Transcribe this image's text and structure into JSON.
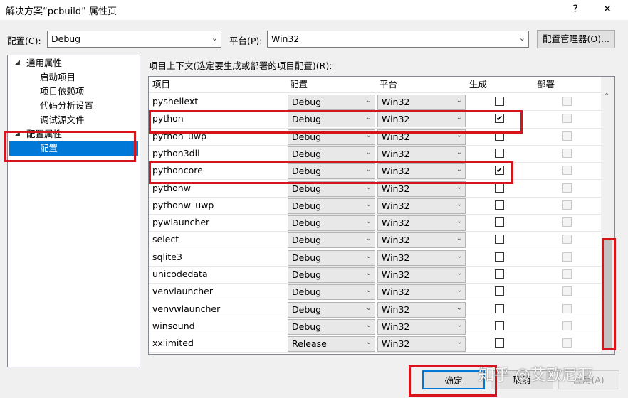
{
  "window": {
    "title": "解决方案“pcbuild” 属性页",
    "help_glyph": "?",
    "close_glyph": "✕"
  },
  "toolbar": {
    "config_label": "配置(C):",
    "config_value": "Debug",
    "platform_label": "平台(P):",
    "platform_value": "Win32",
    "config_manager_label": "配置管理器(O)..."
  },
  "tree": {
    "groups": [
      {
        "label": "通用属性",
        "children": [
          "启动项目",
          "项目依赖项",
          "代码分析设置",
          "调试源文件"
        ]
      },
      {
        "label": "配置属性",
        "children": [
          "配置"
        ]
      }
    ],
    "selected": "配置"
  },
  "grid": {
    "caption": "项目上下文(选定要生成或部署的项目配置)(R):",
    "columns": [
      "项目",
      "配置",
      "平台",
      "生成",
      "部署"
    ],
    "rows": [
      {
        "project": "pyshellext",
        "config": "Debug",
        "platform": "Win32",
        "build": false
      },
      {
        "project": "python",
        "config": "Debug",
        "platform": "Win32",
        "build": true
      },
      {
        "project": "python_uwp",
        "config": "Debug",
        "platform": "Win32",
        "build": false
      },
      {
        "project": "python3dll",
        "config": "Debug",
        "platform": "Win32",
        "build": false
      },
      {
        "project": "pythoncore",
        "config": "Debug",
        "platform": "Win32",
        "build": true
      },
      {
        "project": "pythonw",
        "config": "Debug",
        "platform": "Win32",
        "build": false
      },
      {
        "project": "pythonw_uwp",
        "config": "Debug",
        "platform": "Win32",
        "build": false
      },
      {
        "project": "pywlauncher",
        "config": "Debug",
        "platform": "Win32",
        "build": false
      },
      {
        "project": "select",
        "config": "Debug",
        "platform": "Win32",
        "build": false
      },
      {
        "project": "sqlite3",
        "config": "Debug",
        "platform": "Win32",
        "build": false
      },
      {
        "project": "unicodedata",
        "config": "Debug",
        "platform": "Win32",
        "build": false
      },
      {
        "project": "venvlauncher",
        "config": "Debug",
        "platform": "Win32",
        "build": false
      },
      {
        "project": "venvwlauncher",
        "config": "Debug",
        "platform": "Win32",
        "build": false
      },
      {
        "project": "winsound",
        "config": "Debug",
        "platform": "Win32",
        "build": false
      },
      {
        "project": "xxlimited",
        "config": "Release",
        "platform": "Win32",
        "build": false
      }
    ]
  },
  "footer": {
    "ok_label": "确定",
    "cancel_label": "取消",
    "apply_label": "应用(A)"
  },
  "watermark": "知乎 @艾欧尼亚",
  "colors": {
    "highlight": "#d8131b",
    "selection": "#0078d7"
  }
}
